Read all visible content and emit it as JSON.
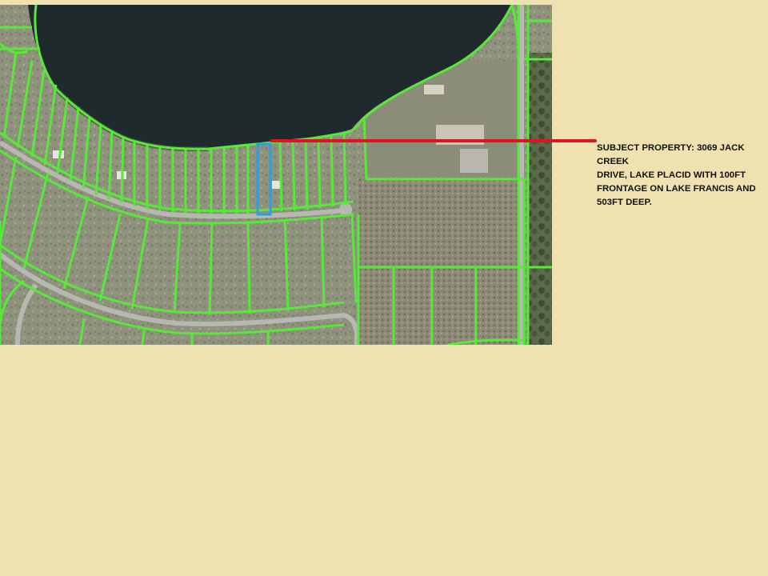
{
  "callout": {
    "text": " SUBJECT PROPERTY: 3069 JACK CREEK\nDRIVE, LAKE PLACID WITH 100FT\nFRONTAGE ON LAKE FRANCIS AND\n503FT DEEP."
  },
  "colors": {
    "background": "#efe2b0",
    "parcel_lines": "#57e83a",
    "subject_parcel": "#2aa0e0",
    "leader_line": "#e0141e",
    "lake": "#1f2a2c",
    "land": "#8f927c",
    "roads": "#b8b8b2"
  },
  "map": {
    "kind": "aerial parcel map",
    "water_body": "lake"
  }
}
